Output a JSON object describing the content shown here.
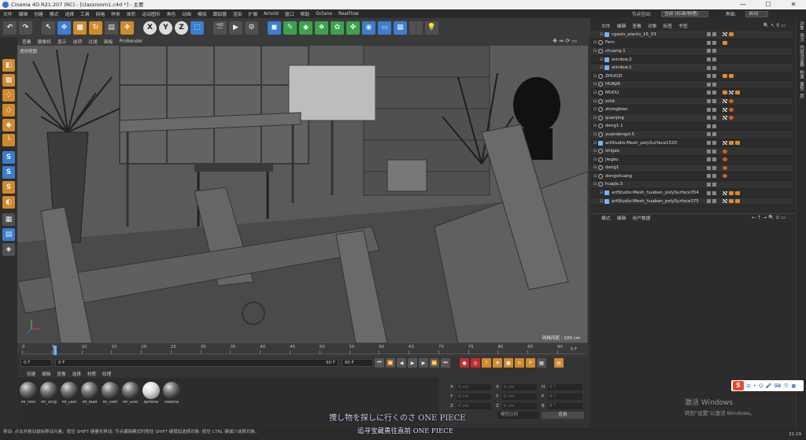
{
  "window": {
    "title": "Cinema 4D R21.207 (RC) - [classroom1.c4d *] - 主要",
    "controls": [
      "—",
      "☐",
      "✕"
    ]
  },
  "menubar": {
    "items": [
      "文件",
      "编辑",
      "创建",
      "模式",
      "选择",
      "工具",
      "网格",
      "样条",
      "体积",
      "运动图形",
      "角色",
      "动画",
      "模拟",
      "跟踪器",
      "渲染",
      "扩展",
      "Arnold",
      "窗口",
      "帮助",
      "Octane",
      "RealFlow"
    ],
    "node_space_label": "节点空间:",
    "node_space_value": "当前 (标准/物理)",
    "layout_label": "界面:",
    "layout_value": "启动"
  },
  "viewport": {
    "menu": [
      "查看",
      "摄像机",
      "显示",
      "选项",
      "过滤",
      "面板",
      "ProRender"
    ],
    "label": "透视视图",
    "grid_info": "网格间距 : 100 cm"
  },
  "timeline": {
    "ticks": [
      "0",
      "5",
      "10",
      "15",
      "20",
      "25",
      "30",
      "35",
      "40",
      "45",
      "50",
      "55",
      "60",
      "65",
      "70",
      "75",
      "80",
      "85",
      "90"
    ],
    "end_frame": "5 F"
  },
  "playback": {
    "current_frame": "0 F",
    "start_field": "0 F",
    "end_field": "90 F",
    "max_field": "90 F"
  },
  "materials": {
    "menu": [
      "创建",
      "编辑",
      "查看",
      "选择",
      "材质",
      "纹理"
    ],
    "items": [
      "Mf_Pets",
      "Mf_Strig",
      "Mf_Leaf",
      "Mf_Blad",
      "Mf_Sten",
      "Mf_Grac",
      "spheres",
      "Materia"
    ]
  },
  "coordinates": {
    "rows": [
      {
        "a": "X",
        "av": "0 cm",
        "b": "X",
        "bv": "0 cm",
        "c": "H",
        "cv": "0 °"
      },
      {
        "a": "Y",
        "av": "0 cm",
        "b": "Y",
        "bv": "0 cm",
        "c": "P",
        "cv": "0 °"
      },
      {
        "a": "Z",
        "av": "0 cm",
        "b": "Z",
        "bv": "0 cm",
        "c": "B",
        "cv": "0 °"
      }
    ],
    "dropdown": "模型比例",
    "apply": "应用"
  },
  "objects": {
    "menu": [
      "文件",
      "编辑",
      "查看",
      "对象",
      "标签",
      "书签"
    ],
    "rows": [
      {
        "name": "cgaxis_plants_16_03",
        "indent": 1,
        "icon": "poly",
        "tags": [
          "c",
          "o"
        ]
      },
      {
        "name": "Fern",
        "indent": 0,
        "icon": "null",
        "tags": [
          "o"
        ]
      },
      {
        "name": "chuang.1",
        "indent": 0,
        "icon": "null",
        "tags": []
      },
      {
        "name": "window.2",
        "indent": 1,
        "icon": "poly",
        "tags": []
      },
      {
        "name": "window.1",
        "indent": 1,
        "icon": "poly",
        "tags": []
      },
      {
        "name": "ZHUOZI",
        "indent": 0,
        "icon": "null",
        "tags": [
          "o",
          "o"
        ]
      },
      {
        "name": "HUAJIA",
        "indent": 0,
        "icon": "null",
        "tags": []
      },
      {
        "name": "MUOU",
        "indent": 0,
        "icon": "null",
        "tags": [
          "o",
          "c",
          "o"
        ]
      },
      {
        "name": "zshk",
        "indent": 0,
        "icon": "null",
        "tags": [
          "c",
          "r"
        ]
      },
      {
        "name": "zhongbiao",
        "indent": 0,
        "icon": "null",
        "tags": [
          "c",
          "r"
        ]
      },
      {
        "name": "quanjing",
        "indent": 0,
        "icon": "null",
        "tags": [
          "c",
          "r"
        ]
      },
      {
        "name": "deng1.1",
        "indent": 0,
        "icon": "null",
        "tags": []
      },
      {
        "name": "yuandengzi.5",
        "indent": 0,
        "icon": "null",
        "tags": []
      },
      {
        "name": "artStudio:Mesh_polySurface1520",
        "indent": 0,
        "icon": "poly",
        "tags": [
          "c",
          "o",
          "o"
        ]
      },
      {
        "name": "shigao",
        "indent": 0,
        "icon": "null",
        "tags": [
          "r"
        ]
      },
      {
        "name": "jiegou",
        "indent": 0,
        "icon": "null",
        "tags": [
          "r"
        ]
      },
      {
        "name": "deng1",
        "indent": 0,
        "icon": "null",
        "tags": [
          "r"
        ]
      },
      {
        "name": "dengshuang",
        "indent": 0,
        "icon": "null",
        "tags": [
          "r"
        ]
      },
      {
        "name": "huajia.3",
        "indent": 0,
        "icon": "null",
        "tags": []
      },
      {
        "name": "artStudio:Mesh_huaban_polySurface354",
        "indent": 1,
        "icon": "poly",
        "tags": [
          "c",
          "o",
          "o"
        ]
      },
      {
        "name": "artStudio:Mesh_huaban_polySurface375",
        "indent": 1,
        "icon": "poly",
        "tags": [
          "c",
          "o",
          "o"
        ]
      }
    ]
  },
  "attributes": {
    "menu": [
      "模式",
      "编辑",
      "用户数据"
    ]
  },
  "side_tabs": [
    "对象",
    "场次",
    "内容浏览器",
    "构造",
    "属性",
    "层"
  ],
  "windows_activation": {
    "title": "激活 Windows",
    "subtitle": "转到\"设置\"以激活 Windows。"
  },
  "ime": {
    "logo": "S",
    "items": [
      "中",
      "•",
      "☺",
      "🎤",
      "⌨",
      "👕",
      "▦"
    ]
  },
  "subtitles": {
    "line1": "捜し物を探しに行くのさ ONE PIECE",
    "line2": "追寻宝藏勇往直前 ONE PIECE"
  },
  "status": {
    "text": "移动: 点击并拖动鼠标移动元素。按住 SHIFT 键量化移动; 节点编辑模式时按住 SHIFT 键增加选择对象; 按住 CTRL 键减少选择对象。",
    "clock": "21:19"
  }
}
